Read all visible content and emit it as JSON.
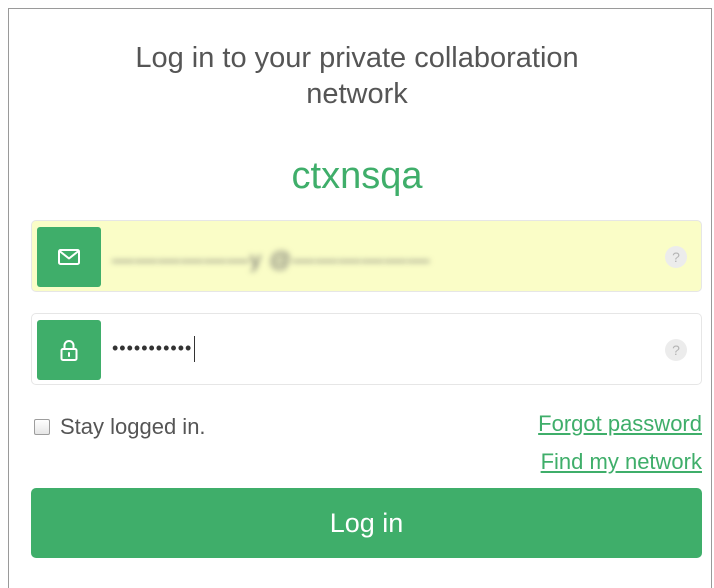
{
  "login": {
    "heading_line1": "Log in to your private collaboration",
    "heading_line2": "network",
    "network_name": "ctxnsqa",
    "email_field": {
      "value_obscured": "——————y   @——————",
      "help_glyph": "?",
      "icon": "envelope-icon"
    },
    "password_field": {
      "value_masked": "•••••••••••",
      "help_glyph": "?",
      "icon": "lock-icon"
    },
    "stay_logged_in_label": "Stay logged in.",
    "forgot_password_link": "Forgot password",
    "find_network_link": "Find my network",
    "login_button": "Log in"
  },
  "colors": {
    "accent": "#3fae6a",
    "autofill_bg": "#fafdc7",
    "text": "#555555"
  }
}
